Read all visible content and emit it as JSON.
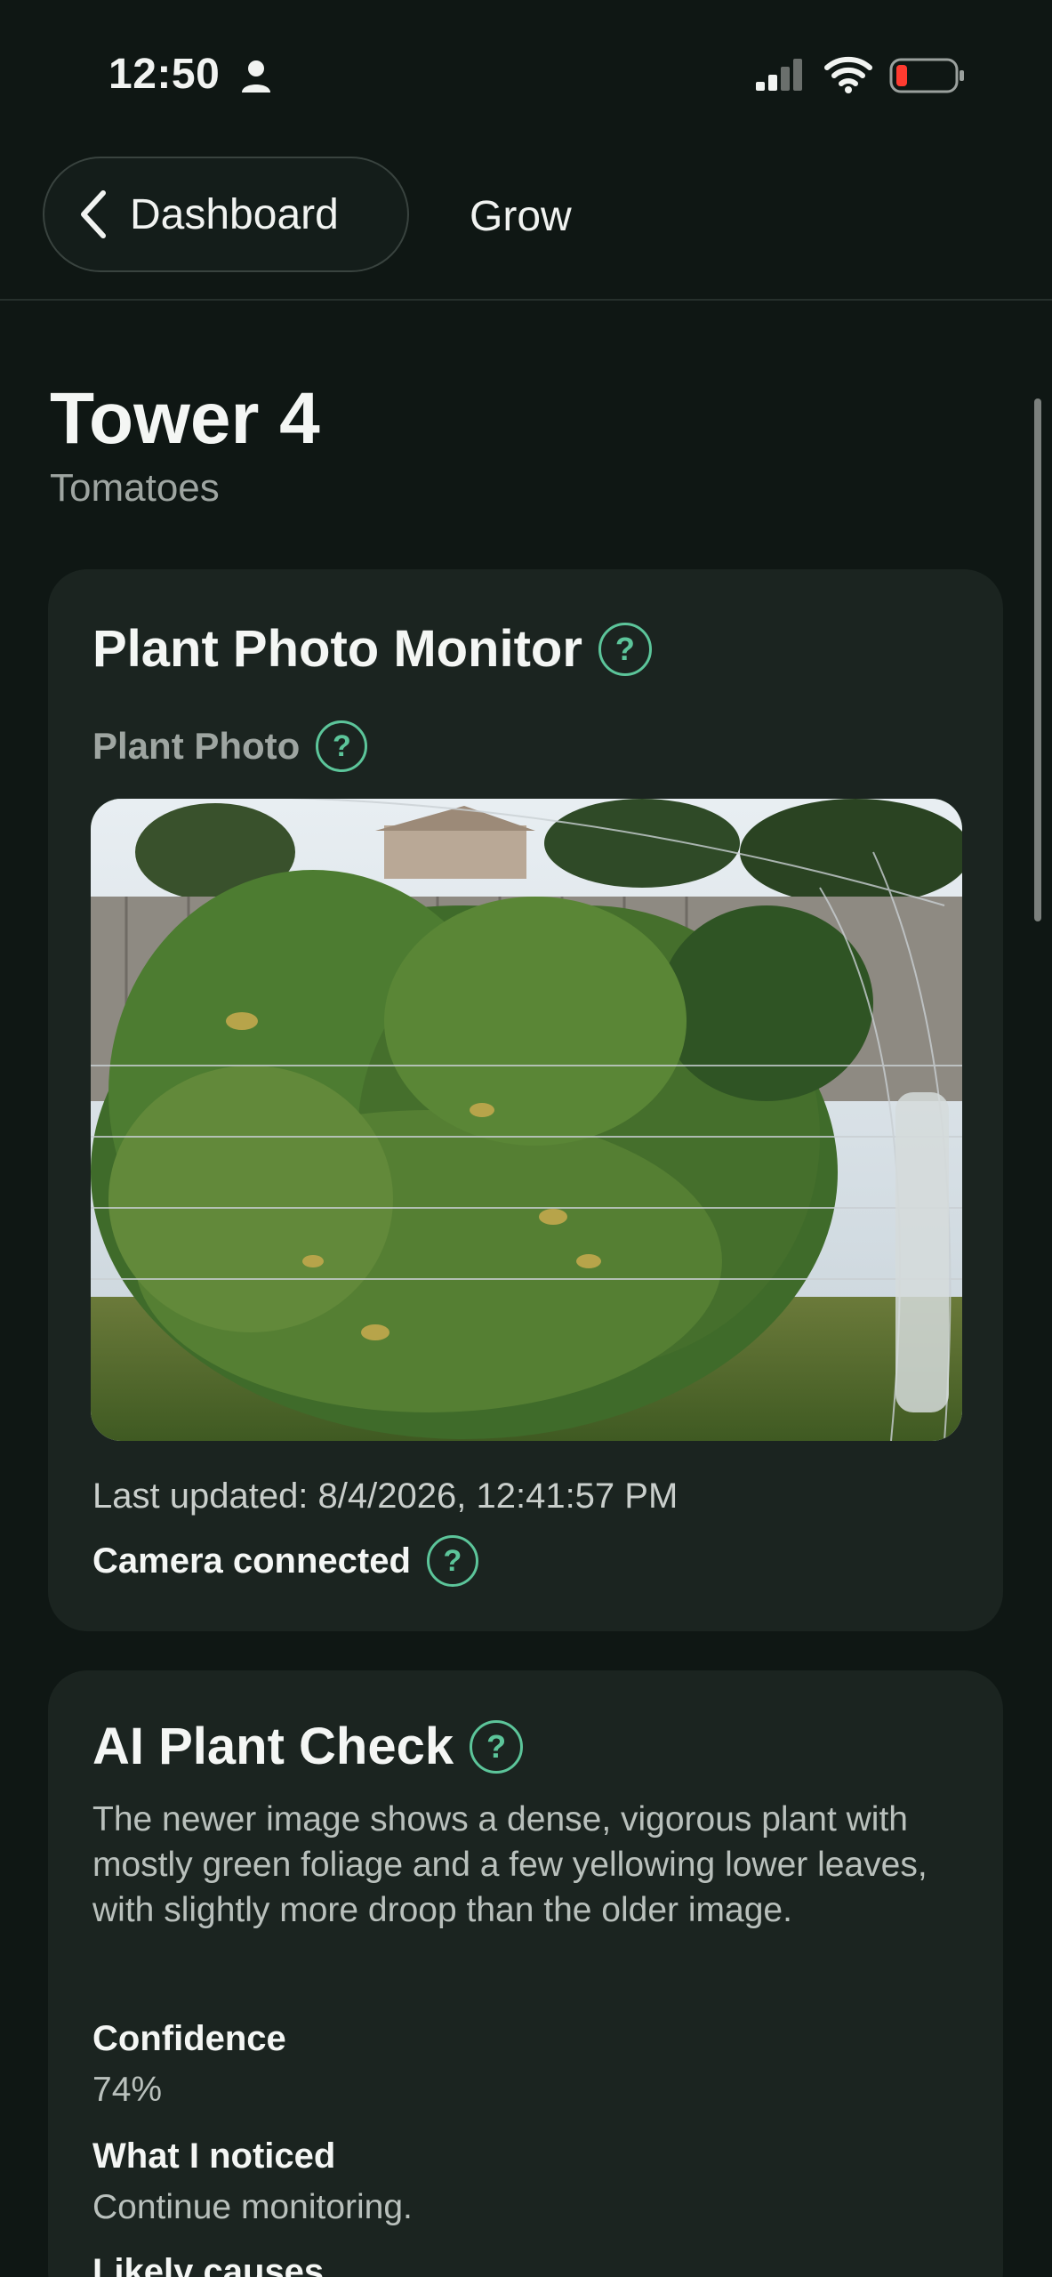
{
  "status_bar": {
    "time": "12:50",
    "icons": [
      "person-icon",
      "signal-icon",
      "wifi-icon",
      "battery-low-icon"
    ],
    "battery_color": "#ff3b30"
  },
  "nav": {
    "back_label": "Dashboard",
    "title": "Grow"
  },
  "header": {
    "title": "Tower 4",
    "subtitle": "Tomatoes"
  },
  "photo_monitor": {
    "title": "Plant Photo Monitor",
    "photo_label": "Plant Photo",
    "last_updated": "Last updated: 8/4/2026, 12:41:57 PM",
    "camera_status": "Camera connected"
  },
  "ai_check": {
    "title": "AI Plant Check",
    "summary": "The newer image shows a dense, vigorous plant with mostly green foliage and a few yellowing lower leaves, with slightly more droop than the older image.",
    "confidence_label": "Confidence",
    "confidence_value": "74%",
    "noticed_label": "What I noticed",
    "noticed_value": "Continue monitoring.",
    "causes_label": "Likely causes"
  },
  "theme": {
    "background": "#0f1714",
    "card": "#1b2420",
    "accent": "#5cc59a"
  }
}
